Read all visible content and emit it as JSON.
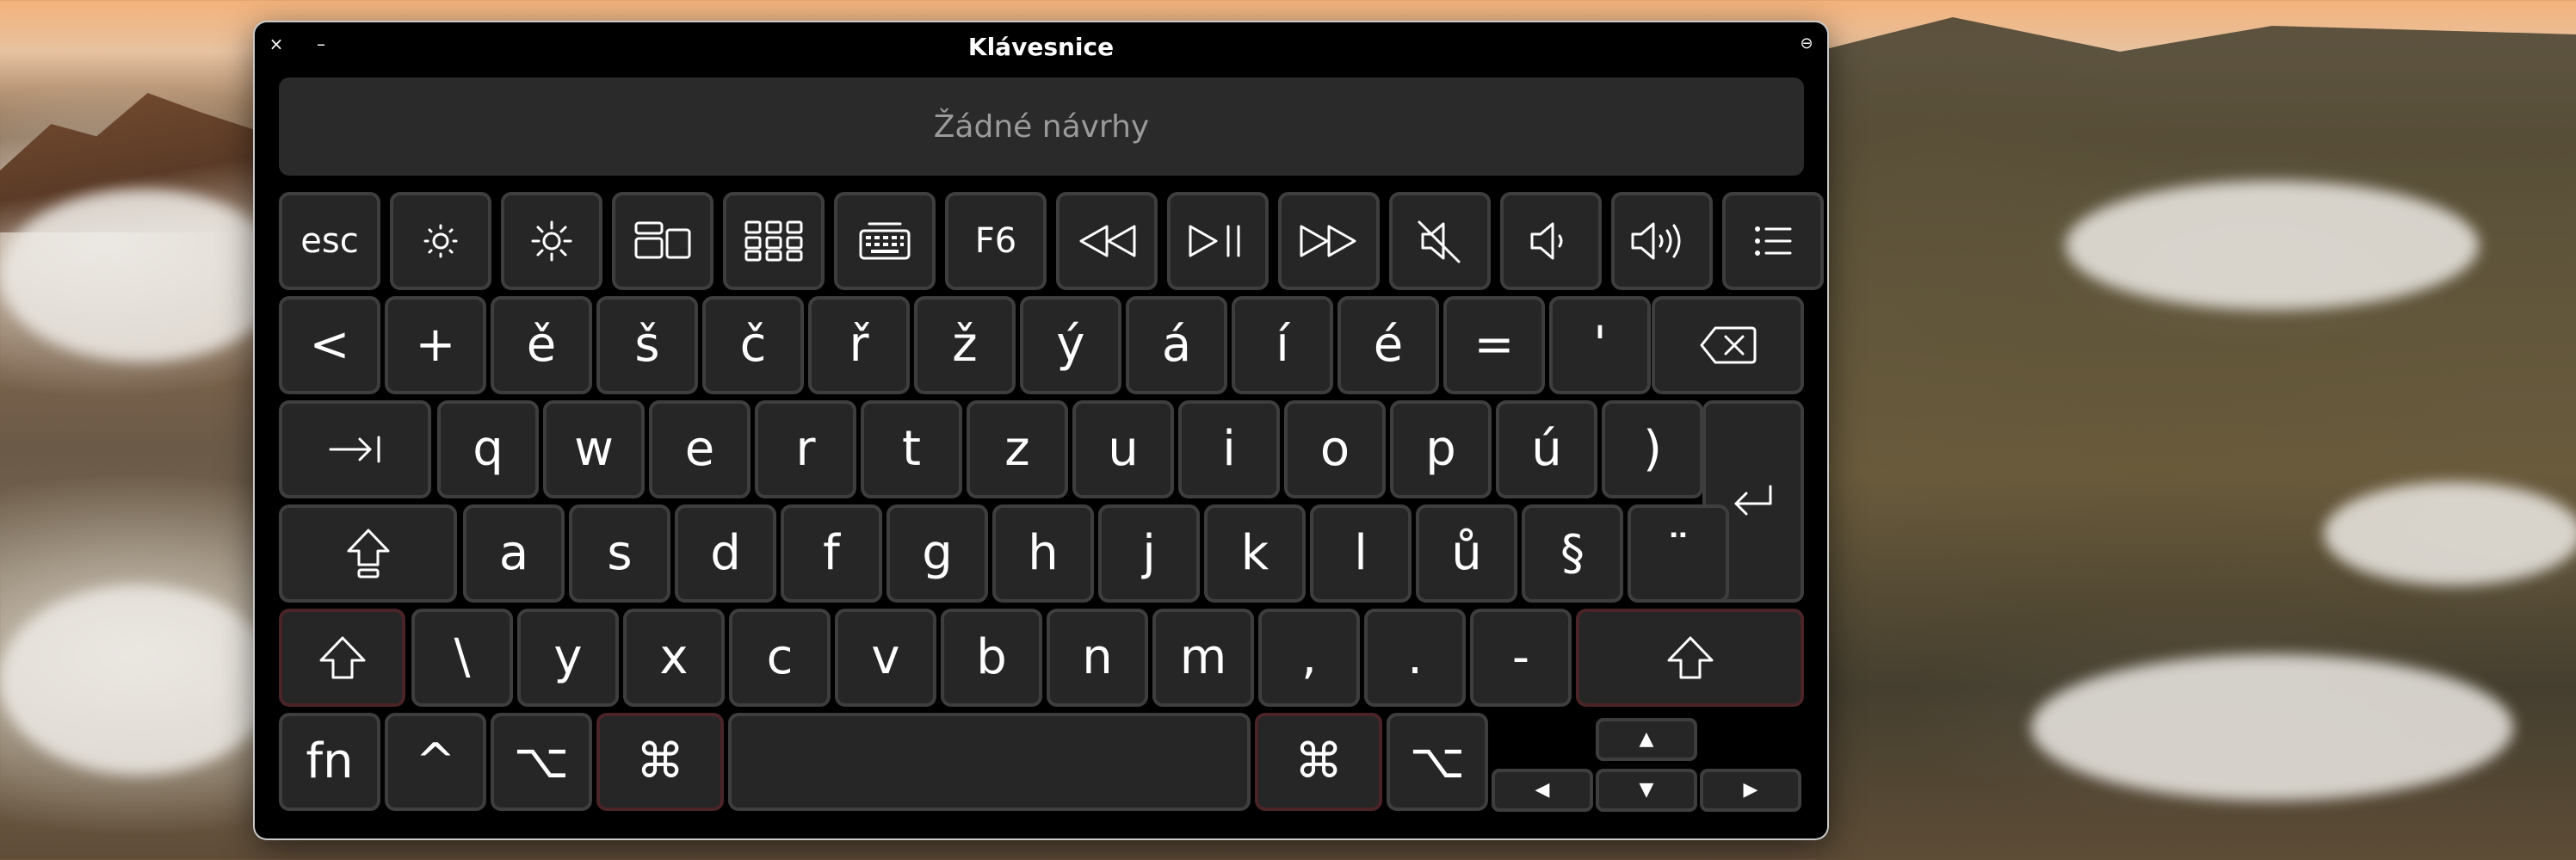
{
  "window": {
    "title": "Klávesnice",
    "close_glyph": "×",
    "minimize_glyph": "–",
    "options_glyph": "⊖"
  },
  "suggestions": {
    "text": "Žádné návrhy"
  },
  "rows": {
    "fn_row": [
      {
        "label": "esc",
        "icon": ""
      },
      {
        "label": "",
        "icon": "brightness-down-icon"
      },
      {
        "label": "",
        "icon": "brightness-up-icon"
      },
      {
        "label": "",
        "icon": "mission-control-icon"
      },
      {
        "label": "",
        "icon": "launchpad-icon"
      },
      {
        "label": "",
        "icon": "keyboard-backlight-icon"
      },
      {
        "label": "F6",
        "icon": ""
      },
      {
        "label": "",
        "icon": "rewind-icon"
      },
      {
        "label": "",
        "icon": "play-pause-icon"
      },
      {
        "label": "",
        "icon": "fast-forward-icon"
      },
      {
        "label": "",
        "icon": "mute-icon"
      },
      {
        "label": "",
        "icon": "volume-down-icon"
      },
      {
        "label": "",
        "icon": "volume-up-icon"
      },
      {
        "label": "",
        "icon": "list-icon"
      }
    ],
    "number_row": [
      "<",
      "+",
      "ě",
      "š",
      "č",
      "ř",
      "ž",
      "ý",
      "á",
      "í",
      "é",
      "=",
      "'"
    ],
    "q_row": [
      "q",
      "w",
      "e",
      "r",
      "t",
      "z",
      "u",
      "i",
      "o",
      "p",
      "ú",
      ")"
    ],
    "a_row": [
      "a",
      "s",
      "d",
      "f",
      "g",
      "h",
      "j",
      "k",
      "l",
      "ů",
      "§",
      "¨"
    ],
    "z_row": [
      "\\",
      "y",
      "x",
      "c",
      "v",
      "b",
      "n",
      "m",
      ",",
      ".",
      "-"
    ],
    "bottom_row": {
      "fn": "fn",
      "control": "^",
      "option_left": "⌥",
      "command_left": "⌘",
      "command_right": "⌘",
      "option_right": "⌥"
    },
    "arrows": {
      "up": "▲",
      "left": "◀",
      "down": "▼",
      "right": "▶"
    }
  },
  "icons": {
    "delete": "delete-left-icon",
    "tab": "tab-icon",
    "return": "return-icon",
    "caps_lock": "caps-lock-icon",
    "shift_left": "shift-icon",
    "shift_right": "shift-icon"
  },
  "colors": {
    "window_bg": "#000000",
    "key_bg": "#262626",
    "key_border": "#3e3e3e",
    "modifier_border": "#4a2426",
    "suggestion_text": "#9a9a9a"
  }
}
